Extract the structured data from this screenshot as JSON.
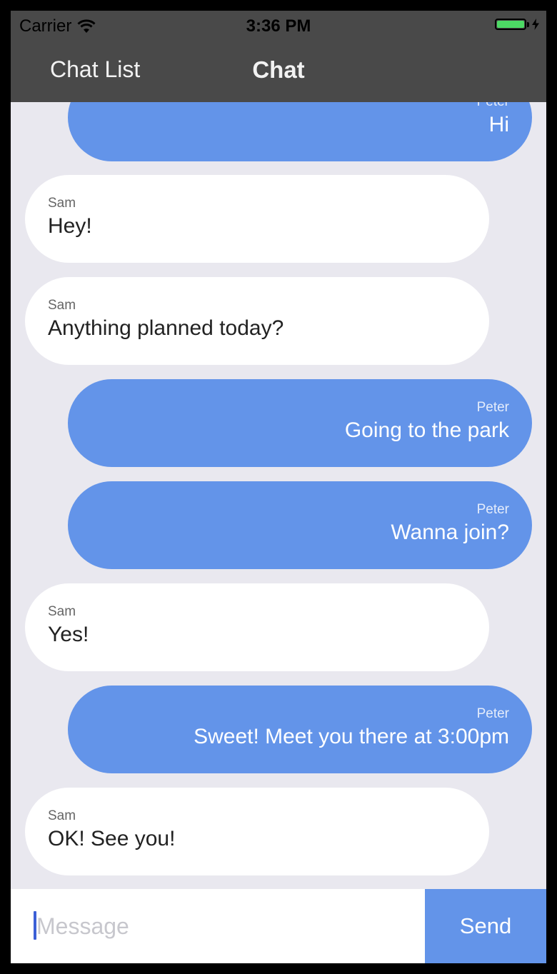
{
  "status_bar": {
    "carrier": "Carrier",
    "time": "3:36 PM",
    "battery_level": 1.0,
    "battery_color": "#4cd964"
  },
  "nav": {
    "back_label": "Chat List",
    "title": "Chat"
  },
  "messages": [
    {
      "sender": "Peter",
      "text": "Hi",
      "direction": "sent"
    },
    {
      "sender": "Sam",
      "text": "Hey!",
      "direction": "received"
    },
    {
      "sender": "Sam",
      "text": "Anything planned today?",
      "direction": "received"
    },
    {
      "sender": "Peter",
      "text": "Going to the park",
      "direction": "sent"
    },
    {
      "sender": "Peter",
      "text": "Wanna join?",
      "direction": "sent"
    },
    {
      "sender": "Sam",
      "text": "Yes!",
      "direction": "received"
    },
    {
      "sender": "Peter",
      "text": "Sweet! Meet you there at 3:00pm",
      "direction": "sent"
    },
    {
      "sender": "Sam",
      "text": "OK! See you!",
      "direction": "received"
    }
  ],
  "composer": {
    "placeholder": "Message",
    "value": "",
    "send_label": "Send"
  },
  "colors": {
    "header_bg": "#494949",
    "sent_bubble": "#6394e9",
    "received_bubble": "#ffffff",
    "chat_bg": "#e9e8ef",
    "send_button": "#6394e9"
  },
  "icons": {
    "wifi": "wifi-icon",
    "battery": "battery-icon",
    "charging": "bolt-icon"
  }
}
